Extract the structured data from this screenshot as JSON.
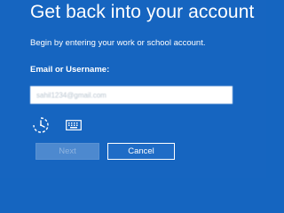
{
  "header": {
    "title": "Get back into your account",
    "subtitle": "Begin by entering your work or school account."
  },
  "form": {
    "email_label": "Email or Username:",
    "email_value": "sahil1234@gmail.com"
  },
  "icons": {
    "ease_of_access": "ease-of-access-icon",
    "keyboard": "on-screen-keyboard-icon"
  },
  "buttons": {
    "next_label": "Next",
    "cancel_label": "Cancel"
  },
  "colors": {
    "background": "#1665c0",
    "input_background": "#ffffff",
    "disabled_button": "#4d89cf",
    "cancel_button_border": "#ffffff"
  }
}
